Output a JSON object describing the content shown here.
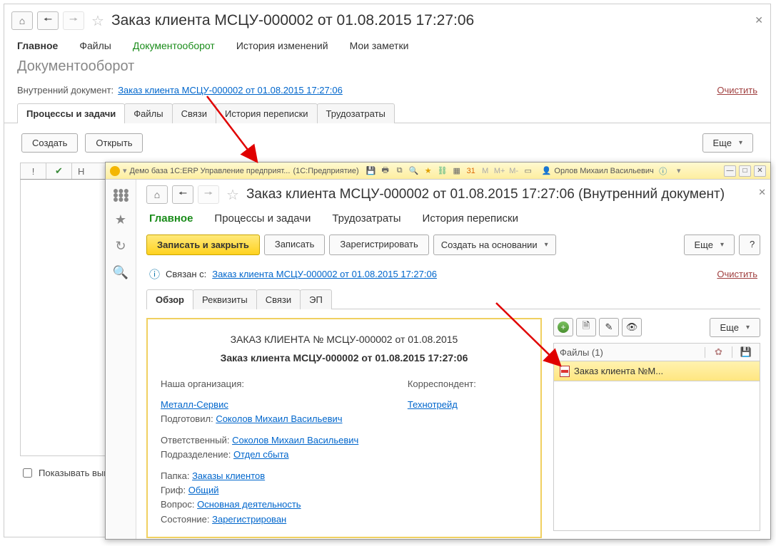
{
  "outer": {
    "title": "Заказ клиента МСЦУ-000002 от 01.08.2015 17:27:06",
    "tabs": [
      "Главное",
      "Файлы",
      "Документооборот",
      "История изменений",
      "Мои заметки"
    ],
    "subheading": "Документооборот",
    "internal_label": "Внутренний документ:",
    "internal_link": "Заказ клиента МСЦУ-000002 от 01.08.2015 17:27:06",
    "clear": "Очистить",
    "tabs2": [
      "Процессы и задачи",
      "Файлы",
      "Связи",
      "История переписки",
      "Трудозатраты"
    ],
    "create": "Создать",
    "open": "Открыть",
    "more": "Еще",
    "show_done": "Показывать выпо"
  },
  "inner": {
    "titlebar": {
      "app": "Демо база 1С:ERP Управление предприят...",
      "mode": "(1С:Предприятие)",
      "user": "Орлов Михаил Васильевич"
    },
    "title": "Заказ клиента МСЦУ-000002 от 01.08.2015 17:27:06 (Внутренний документ)",
    "tabs": [
      "Главное",
      "Процессы и задачи",
      "Трудозатраты",
      "История переписки"
    ],
    "buttons": {
      "save_close": "Записать и закрыть",
      "save": "Записать",
      "register": "Зарегистрировать",
      "create_on": "Создать на основании",
      "more": "Еще",
      "question": "?"
    },
    "linked_label": "Связан с:",
    "linked_link": "Заказ клиента МСЦУ-000002 от 01.08.2015 17:27:06",
    "clear": "Очистить",
    "tabs3": [
      "Обзор",
      "Реквизиты",
      "Связи",
      "ЭП"
    ],
    "doc": {
      "h1": "ЗАКАЗ КЛИЕНТА № МСЦУ-000002 от 01.08.2015",
      "h2": "Заказ клиента МСЦУ-000002 от 01.08.2015 17:27:06",
      "our_org_lbl": "Наша организация:",
      "our_org": "Металл-Сервис",
      "prepared_lbl": "Подготовил:",
      "prepared": "Соколов Михаил Васильевич",
      "corr_lbl": "Корреспондент:",
      "corr": "Технотрейд",
      "resp_lbl": "Ответственный:",
      "resp": "Соколов Михаил Васильевич",
      "dept_lbl": "Подразделение:",
      "dept": "Отдел сбыта",
      "folder_lbl": "Папка:",
      "folder": "Заказы клиентов",
      "grif_lbl": "Гриф:",
      "grif": "Общий",
      "vopros_lbl": "Вопрос:",
      "vopros": "Основная деятельность",
      "state_lbl": "Состояние:",
      "state": "Зарегистрирован"
    },
    "files": {
      "header": "Файлы (1)",
      "more": "Еще",
      "item": "Заказ клиента №М..."
    }
  }
}
